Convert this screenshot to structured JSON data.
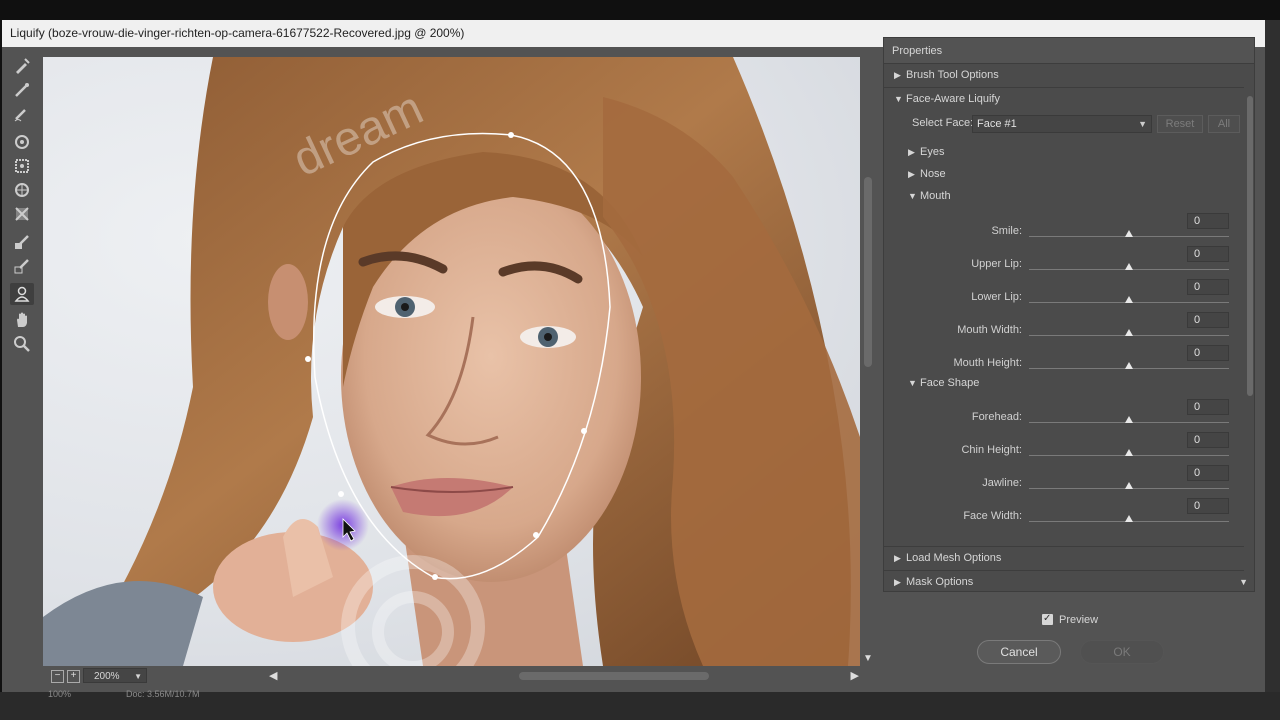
{
  "window": {
    "title": "Liquify (boze-vrouw-die-vinger-richten-op-camera-61677522-Recovered.jpg @ 200%)"
  },
  "tools": [
    {
      "name": "forward-warp-tool-icon"
    },
    {
      "name": "reconstruct-tool-icon"
    },
    {
      "name": "smooth-tool-icon"
    },
    {
      "name": "twirl-clockwise-tool-icon"
    },
    {
      "name": "pucker-tool-icon"
    },
    {
      "name": "bloat-tool-icon"
    },
    {
      "name": "push-left-tool-icon"
    },
    {
      "name": "freeze-mask-tool-icon"
    },
    {
      "name": "thaw-mask-tool-icon"
    },
    {
      "name": "face-tool-icon",
      "active": true
    },
    {
      "name": "hand-tool-icon"
    },
    {
      "name": "zoom-tool-icon"
    }
  ],
  "status": {
    "zoom": "200%",
    "zoom_out": "−",
    "zoom_in": "+",
    "bottom_zoom": "100%",
    "doc": "Doc: 3.56M/10.7M"
  },
  "properties": {
    "title": "Properties",
    "brush_tool_options": "Brush Tool Options",
    "face_aware_liquify": "Face-Aware Liquify",
    "select_face_label": "Select Face:",
    "select_face_value": "Face #1",
    "reset": "Reset",
    "all": "All",
    "eyes": "Eyes",
    "nose": "Nose",
    "mouth": "Mouth",
    "mouth_sliders": [
      {
        "label": "Smile:",
        "value": "0"
      },
      {
        "label": "Upper Lip:",
        "value": "0"
      },
      {
        "label": "Lower Lip:",
        "value": "0"
      },
      {
        "label": "Mouth Width:",
        "value": "0"
      },
      {
        "label": "Mouth Height:",
        "value": "0"
      }
    ],
    "face_shape": "Face Shape",
    "face_shape_sliders": [
      {
        "label": "Forehead:",
        "value": "0"
      },
      {
        "label": "Chin Height:",
        "value": "0"
      },
      {
        "label": "Jawline:",
        "value": "0"
      },
      {
        "label": "Face Width:",
        "value": "0"
      }
    ],
    "load_mesh_options": "Load Mesh Options",
    "mask_options": "Mask Options"
  },
  "footer": {
    "preview": "Preview",
    "cancel": "Cancel",
    "ok": "OK"
  },
  "watermark": "dream"
}
